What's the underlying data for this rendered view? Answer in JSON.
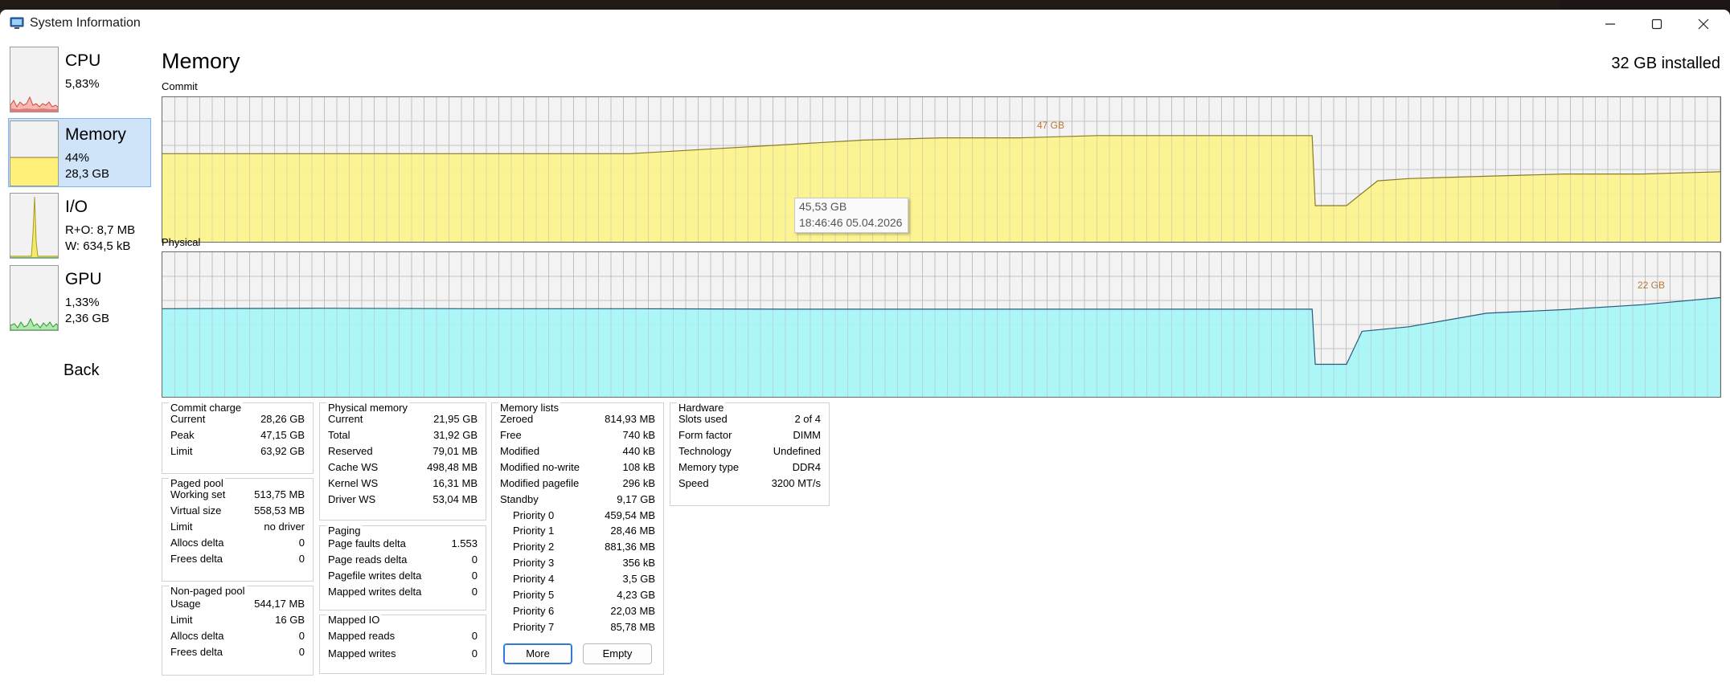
{
  "window": {
    "title": "System Information"
  },
  "controls": {
    "minimize": "minimize-icon",
    "maximize": "maximize-icon",
    "close": "close-icon"
  },
  "sidebar": {
    "items": [
      {
        "title": "CPU",
        "line1": "5,83%",
        "line2": "",
        "graph_color": "#e0564e",
        "fill": "#f5b8b2"
      },
      {
        "title": "Memory",
        "line1": "44%",
        "line2": "28,3 GB",
        "selected": true,
        "fill": "#fff07a"
      },
      {
        "title": "I/O",
        "line1": "R+O: 8,7 MB",
        "line2": "W: 634,5 kB",
        "fill": "#f3ea6a"
      },
      {
        "title": "GPU",
        "line1": "1,33%",
        "line2": "2,36 GB",
        "fill": "#6fd36f"
      }
    ],
    "back": "Back"
  },
  "main": {
    "title": "Memory",
    "installed": "32 GB installed",
    "commit_label": "Commit",
    "physical_label": "Physical",
    "commit_peak_label": "47 GB",
    "physical_peak_label": "22 GB",
    "tooltip": {
      "value": "45,53 GB",
      "time": "18:46:46 05.04.2026"
    }
  },
  "colors": {
    "commit_fill": "#fdf48a",
    "commit_line": "#8a7a2a",
    "physical_fill": "#a6f6f8",
    "physical_line": "#2a5a7a",
    "grid": "#c6c6c6",
    "selected": "#cfe4f9"
  },
  "chart_data": [
    {
      "type": "area",
      "name_shown": "Commit",
      "ylim": [
        0,
        64
      ],
      "ylabel": "GB",
      "x": [
        0,
        5,
        10,
        15,
        20,
        25,
        30,
        35,
        40,
        45,
        50,
        55,
        60,
        65,
        70,
        73.8,
        74,
        76,
        78,
        80,
        85,
        90,
        95,
        100
      ],
      "values": [
        39,
        39,
        39,
        39,
        39,
        39,
        39,
        41,
        43,
        45,
        46,
        46,
        47,
        47,
        47,
        47,
        16,
        16,
        27,
        28,
        29,
        30,
        30,
        31
      ],
      "annotations": [
        "47 GB",
        "45,53 GB",
        "18:46:46 05.04.2026"
      ]
    },
    {
      "type": "area",
      "name_shown": "Physical",
      "ylim": [
        0,
        32
      ],
      "ylabel": "GB",
      "x": [
        0,
        10,
        20,
        30,
        40,
        50,
        60,
        70,
        73.8,
        74,
        76,
        77,
        80,
        85,
        90,
        95,
        100
      ],
      "values": [
        19.5,
        19.6,
        19.5,
        19.5,
        19.4,
        19.4,
        19.4,
        19.4,
        19.4,
        7.2,
        7.2,
        14.5,
        15.5,
        18.5,
        19.3,
        20.4,
        21.95
      ],
      "annotations": [
        "22 GB"
      ]
    }
  ],
  "panels": {
    "commit": {
      "title": "Commit charge",
      "rows": [
        [
          "Current",
          "28,26 GB"
        ],
        [
          "Peak",
          "47,15 GB"
        ],
        [
          "Limit",
          "63,92 GB"
        ]
      ]
    },
    "paged": {
      "title": "Paged pool",
      "rows": [
        [
          "Working set",
          "513,75 MB"
        ],
        [
          "Virtual size",
          "558,53 MB"
        ],
        [
          "Limit",
          "no driver"
        ],
        [
          "Allocs delta",
          "0"
        ],
        [
          "Frees delta",
          "0"
        ]
      ]
    },
    "nonpaged": {
      "title": "Non-paged pool",
      "rows": [
        [
          "Usage",
          "544,17 MB"
        ],
        [
          "Limit",
          "16 GB"
        ],
        [
          "Allocs delta",
          "0"
        ],
        [
          "Frees delta",
          "0"
        ]
      ]
    },
    "physical": {
      "title": "Physical memory",
      "rows": [
        [
          "Current",
          "21,95 GB"
        ],
        [
          "Total",
          "31,92 GB"
        ],
        [
          "Reserved",
          "79,01 MB"
        ],
        [
          "Cache WS",
          "498,48 MB"
        ],
        [
          "Kernel WS",
          "16,31 MB"
        ],
        [
          "Driver WS",
          "53,04 MB"
        ]
      ]
    },
    "paging": {
      "title": "Paging",
      "rows": [
        [
          "Page faults delta",
          "1.553"
        ],
        [
          "Page reads delta",
          "0"
        ],
        [
          "Pagefile writes delta",
          "0"
        ],
        [
          "Mapped writes delta",
          "0"
        ]
      ]
    },
    "mapped": {
      "title": "Mapped IO",
      "rows": [
        [
          "Mapped reads",
          "0"
        ],
        [
          "Mapped writes",
          "0"
        ]
      ]
    },
    "lists": {
      "title": "Memory lists",
      "rows": [
        [
          "Zeroed",
          "814,93 MB"
        ],
        [
          "Free",
          "740 kB"
        ],
        [
          "Modified",
          "440 kB"
        ],
        [
          "Modified no-write",
          "108 kB"
        ],
        [
          "Modified pagefile",
          "296 kB"
        ],
        [
          "Standby",
          "9,17 GB"
        ]
      ],
      "priorities": [
        [
          "Priority 0",
          "459,54 MB"
        ],
        [
          "Priority 1",
          "28,46 MB"
        ],
        [
          "Priority 2",
          "881,36 MB"
        ],
        [
          "Priority 3",
          "356 kB"
        ],
        [
          "Priority 4",
          "3,5 GB"
        ],
        [
          "Priority 5",
          "4,23 GB"
        ],
        [
          "Priority 6",
          "22,03 MB"
        ],
        [
          "Priority 7",
          "85,78 MB"
        ]
      ],
      "more": "More",
      "empty": "Empty"
    },
    "hardware": {
      "title": "Hardware",
      "rows": [
        [
          "Slots used",
          "2 of 4"
        ],
        [
          "Form factor",
          "DIMM"
        ],
        [
          "Technology",
          "Undefined"
        ],
        [
          "Memory type",
          "DDR4"
        ],
        [
          "Speed",
          "3200 MT/s"
        ]
      ]
    }
  }
}
